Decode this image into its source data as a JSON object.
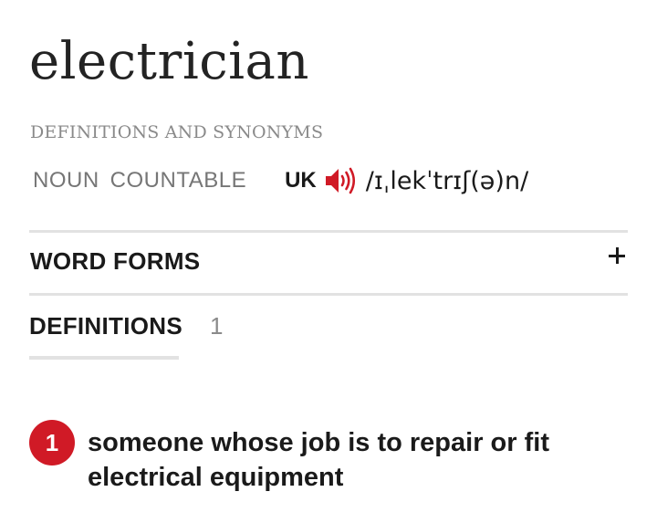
{
  "entry": {
    "headword": "electrician",
    "section_label": "DEFINITIONS AND SYNONYMS",
    "parts_of_speech": [
      "NOUN",
      "COUNTABLE"
    ],
    "region": "UK",
    "pronunciation": "/ɪˌlekˈtrɪʃ(ə)n/"
  },
  "word_forms": {
    "label": "WORD FORMS",
    "toggle_icon": "plus-icon"
  },
  "definitions": {
    "label": "DEFINITIONS",
    "count": "1",
    "items": [
      {
        "number": "1",
        "text": "someone whose job is to repair or fit electrical equipment"
      }
    ]
  },
  "colors": {
    "accent": "#d01a26",
    "divider": "#e2e2e2",
    "muted_text": "#8a8a8a",
    "body_text": "#1a1a1a"
  }
}
